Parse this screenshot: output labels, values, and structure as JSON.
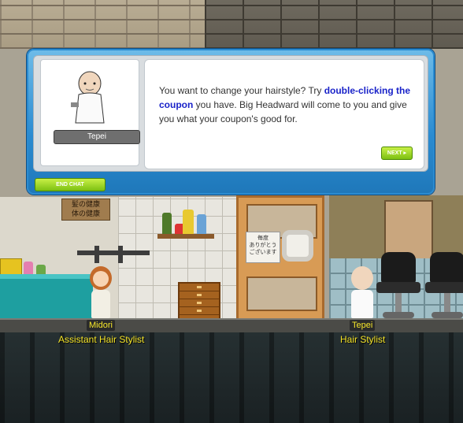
{
  "dialog": {
    "speaker_name": "Tepei",
    "message_parts": [
      {
        "text": "You want to change your hairstyle? Try ",
        "highlight": false
      },
      {
        "text": "double-clicking the coupon",
        "highlight": true
      },
      {
        "text": " you have. Big Headward will come to you and give you what your coupon's good for.",
        "highlight": false
      }
    ],
    "next_label": "NEXT",
    "end_chat_label": "END CHAT"
  },
  "scene": {
    "sign_text": "髪の健康\n体の健康",
    "door_sign_text": "毎度\nありがとう\nございます",
    "npcs": [
      {
        "name": "Midori",
        "title": "Assistant Hair Stylist"
      },
      {
        "name": "Tepei",
        "title": "Hair Stylist"
      }
    ]
  },
  "colors": {
    "dialog_frame": "#2a8bd1",
    "highlight_text": "#1a23c9",
    "name_text": "#f5e52a",
    "button_green": "#7cc012"
  }
}
